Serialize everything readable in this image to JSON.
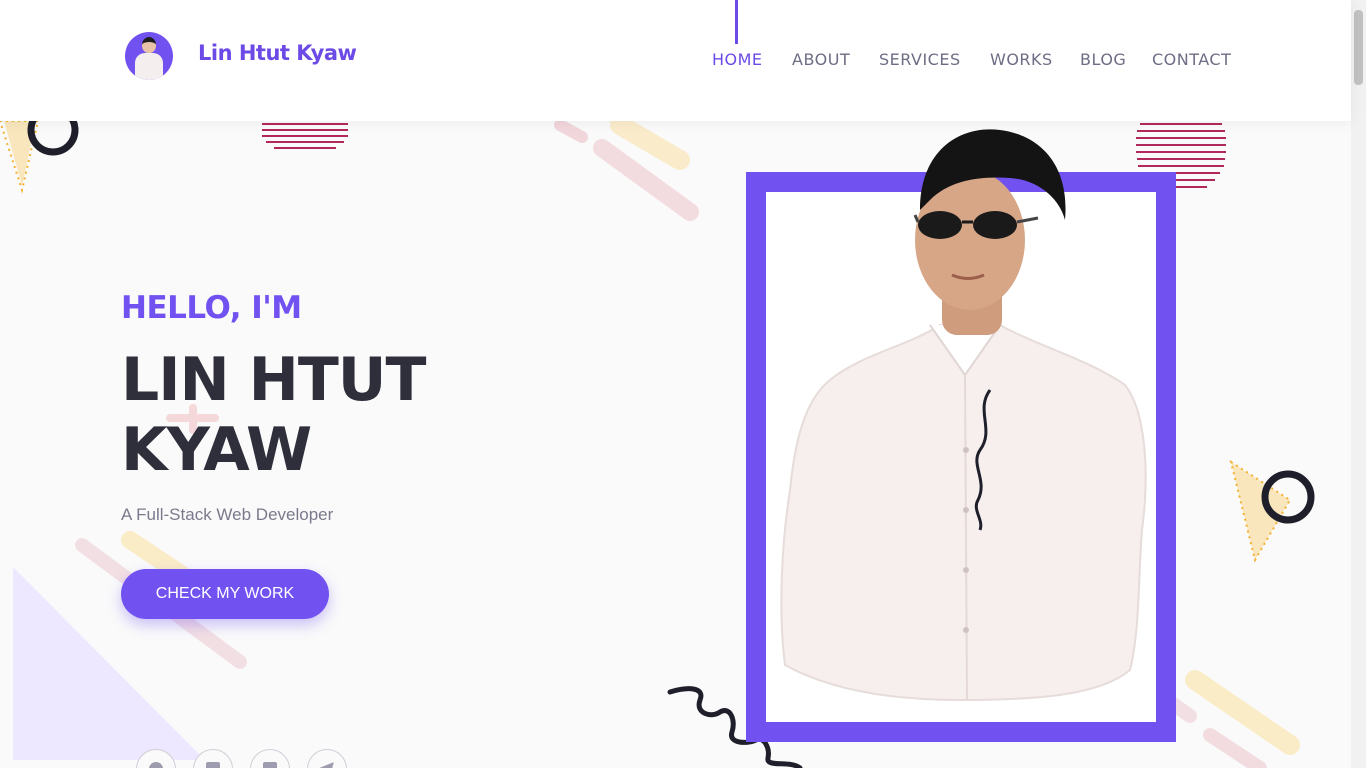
{
  "brand": {
    "name": "Lin Htut Kyaw",
    "avatar_icon": "profile-photo"
  },
  "nav": {
    "items": [
      {
        "label": "HOME",
        "active": true
      },
      {
        "label": "ABOUT",
        "active": false
      },
      {
        "label": "SERVICES",
        "active": false
      },
      {
        "label": "WORKS",
        "active": false
      },
      {
        "label": "BLOG",
        "active": false
      },
      {
        "label": "CONTACT",
        "active": false
      }
    ]
  },
  "hero": {
    "greeting": "HELLO, I'M",
    "name": "LIN HTUT KYAW",
    "tagline": "A Full-Stack Web Developer",
    "cta_label": "CHECK MY WORK"
  },
  "socials": [
    {
      "icon": "github-icon"
    },
    {
      "icon": "linkedin-icon"
    },
    {
      "icon": "facebook-icon"
    },
    {
      "icon": "telegram-icon"
    }
  ],
  "colors": {
    "accent": "#7152f0",
    "heading": "#2f2f3b",
    "nav_text": "#6d6d85",
    "background": "#fafafa"
  }
}
